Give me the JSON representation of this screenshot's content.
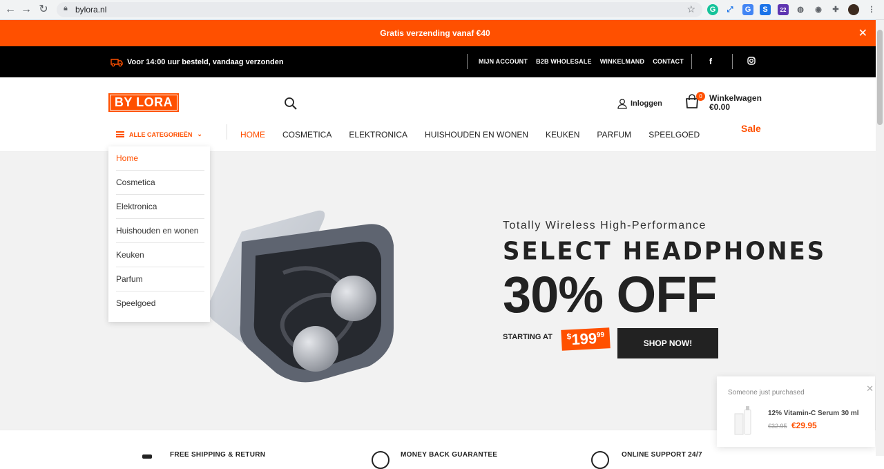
{
  "browser": {
    "url": "bylora.nl",
    "extension_badge": "22"
  },
  "announcement": {
    "text": "Gratis verzending vanaf €40"
  },
  "topbar": {
    "shipping_text": "Voor 14:00 uur besteld, vandaag verzonden",
    "links": [
      "MIJN ACCOUNT",
      "B2B WHOLESALE",
      "WINKELMAND",
      "CONTACT"
    ],
    "social": [
      "f"
    ]
  },
  "header": {
    "logo": "BY LORA",
    "login_label": "Inloggen",
    "cart_count": "0",
    "cart_label": "Winkelwagen",
    "cart_total": "€0.00",
    "all_categories": "ALLE CATEGORIEËN",
    "nav": [
      "HOME",
      "COSMETICA",
      "ELEKTRONICA",
      "HUISHOUDEN EN WONEN",
      "KEUKEN",
      "PARFUM",
      "SPEELGOED"
    ],
    "sale": "Sale"
  },
  "category_menu": {
    "items": [
      "Home",
      "Cosmetica",
      "Elektronica",
      "Huishouden en wonen",
      "Keuken",
      "Parfum",
      "Speelgoed"
    ]
  },
  "hero": {
    "subtitle": "Totally Wireless High-Performance",
    "title": "SELECT HEADPHONES",
    "discount": "30% OFF",
    "starting_at": "STARTING AT",
    "price_currency": "$",
    "price_whole": "199",
    "price_cents": "99",
    "cta": "SHOP NOW!"
  },
  "features": [
    "FREE SHIPPING & RETURN",
    "MONEY BACK GUARANTEE",
    "ONLINE SUPPORT 24/7"
  ],
  "toast": {
    "label": "Someone just purchased",
    "product": "12% Vitamin-C Serum 30 ml",
    "old_price": "€32.95",
    "new_price": "€29.95"
  },
  "colors": {
    "accent": "#ff5000",
    "dark": "#222222"
  }
}
